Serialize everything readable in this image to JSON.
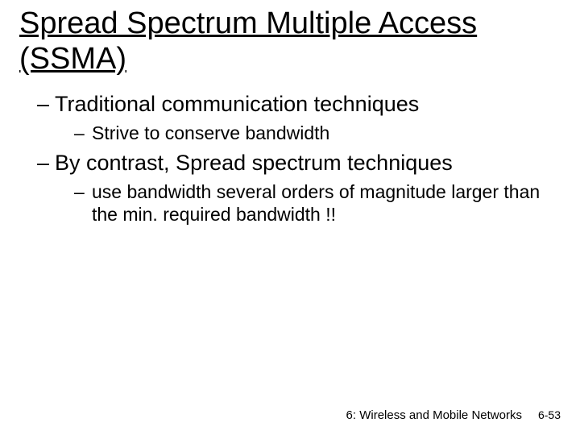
{
  "title": "Spread Spectrum Multiple Access (SSMA)",
  "bullets": {
    "b1": "Traditional communication techniques",
    "b1_1": "Strive to conserve bandwidth",
    "b2": "By contrast, Spread spectrum techniques",
    "b2_1": "use bandwidth several orders of magnitude larger than the min. required bandwidth !!"
  },
  "footer": {
    "chapter": "6: Wireless and Mobile Networks",
    "page": "6-53"
  },
  "dash": "–"
}
